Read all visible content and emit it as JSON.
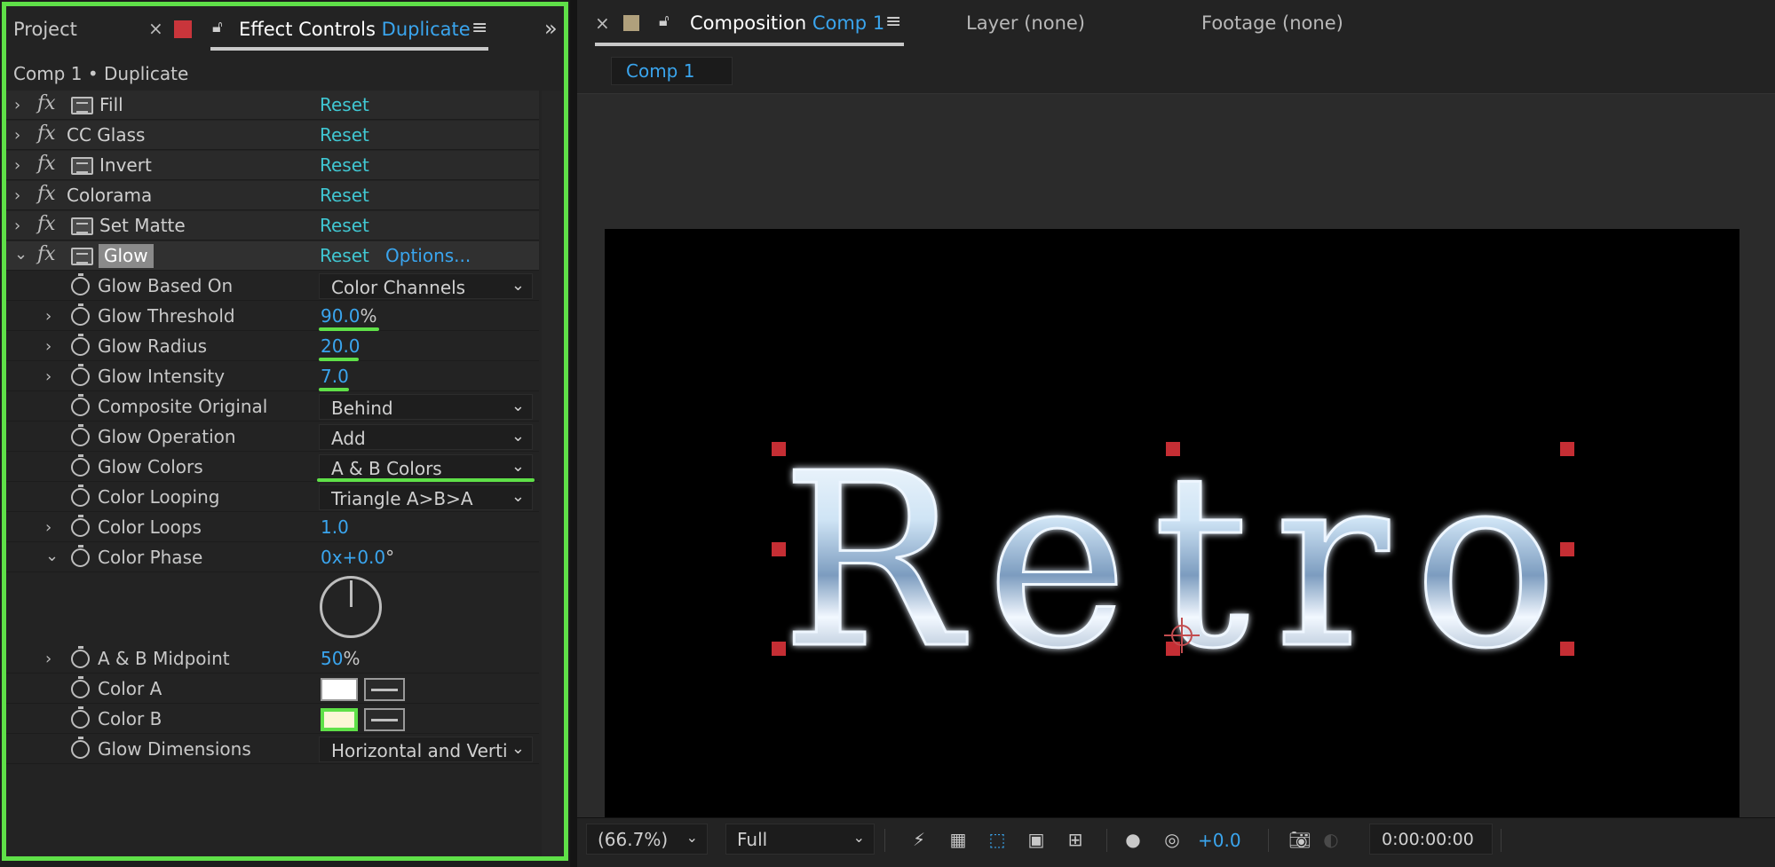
{
  "left_panel": {
    "tabs": {
      "project": "Project",
      "close": "×",
      "effect_controls_prefix": "Effect Controls",
      "effect_controls_layer": "Duplicate",
      "menu": "≡",
      "overflow": "»"
    },
    "comp_label": "Comp 1 • Duplicate",
    "effects": [
      {
        "name": "Fill",
        "reset": "Reset",
        "has_box": true
      },
      {
        "name": "CC Glass",
        "reset": "Reset",
        "has_box": false
      },
      {
        "name": "Invert",
        "reset": "Reset",
        "has_box": true
      },
      {
        "name": "Colorama",
        "reset": "Reset",
        "has_box": false
      },
      {
        "name": "Set Matte",
        "reset": "Reset",
        "has_box": true
      }
    ],
    "glow": {
      "name": "Glow",
      "reset": "Reset",
      "options": "Options...",
      "properties": {
        "glow_based_on": {
          "label": "Glow Based On",
          "value": "Color Channels"
        },
        "glow_threshold": {
          "label": "Glow Threshold",
          "value": "90.0",
          "suffix": "%"
        },
        "glow_radius": {
          "label": "Glow Radius",
          "value": "20.0"
        },
        "glow_intensity": {
          "label": "Glow Intensity",
          "value": "7.0"
        },
        "composite_original": {
          "label": "Composite Original",
          "value": "Behind"
        },
        "glow_operation": {
          "label": "Glow Operation",
          "value": "Add"
        },
        "glow_colors": {
          "label": "Glow Colors",
          "value": "A & B Colors"
        },
        "color_looping": {
          "label": "Color Looping",
          "value": "Triangle A>B>A"
        },
        "color_loops": {
          "label": "Color Loops",
          "value": "1.0"
        },
        "color_phase": {
          "label": "Color Phase",
          "value_prefix": "0x",
          "value": "+0.0",
          "suffix": "°"
        },
        "ab_midpoint": {
          "label": "A & B Midpoint",
          "value": "50",
          "suffix": "%"
        },
        "color_a": {
          "label": "Color A",
          "color": "#ffffff"
        },
        "color_b": {
          "label": "Color B",
          "color": "#fcf6d6"
        },
        "glow_dimensions": {
          "label": "Glow Dimensions",
          "value": "Horizontal and Verti"
        }
      }
    }
  },
  "right_panel": {
    "composition_tab": {
      "prefix": "Composition",
      "name": "Comp 1",
      "menu": "≡",
      "close": "×"
    },
    "layer_tab": "Layer (none)",
    "footage_tab": "Footage (none)",
    "comp_chip": "Comp 1",
    "canvas_text": "Retro",
    "bottom_bar": {
      "zoom": "(66.7%)",
      "resolution": "Full",
      "exposure": "+0.0",
      "timecode": "0:00:00:00"
    }
  },
  "colors": {
    "highlight_green": "#5fe048",
    "accent_blue": "#3aa5ee",
    "reset_teal": "#40c7d2",
    "label_red": "#c9353b",
    "label_tan": "#b0a07c"
  }
}
